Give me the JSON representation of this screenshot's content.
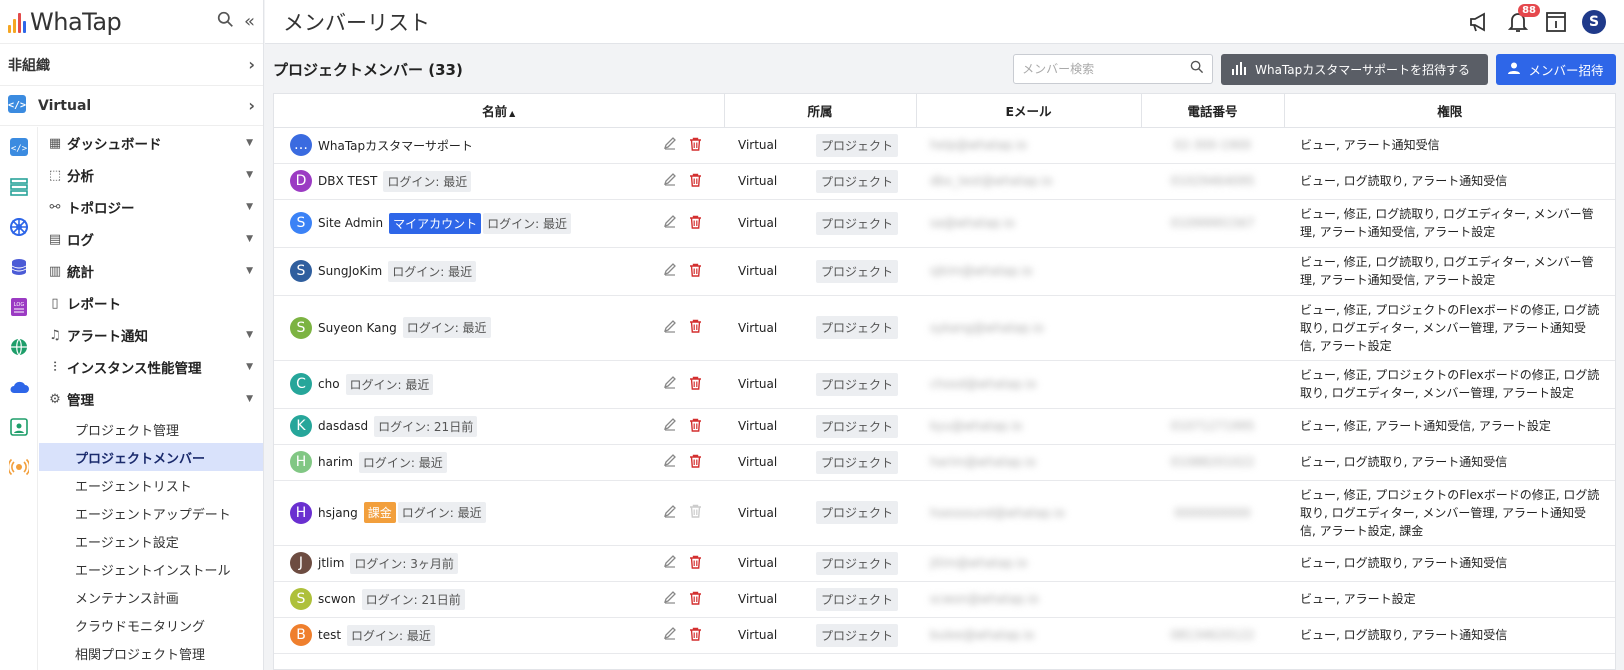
{
  "app": {
    "logo_text": "WhaTap"
  },
  "sidebar": {
    "org": "非組織",
    "project": "Virtual",
    "menu": [
      {
        "label": "ダッシュボード"
      },
      {
        "label": "分析"
      },
      {
        "label": "トポロジー"
      },
      {
        "label": "ログ"
      },
      {
        "label": "統計"
      },
      {
        "label": "レポート"
      },
      {
        "label": "アラート通知"
      },
      {
        "label": "インスタンス性能管理"
      },
      {
        "label": "管理"
      }
    ],
    "submenu": [
      {
        "label": "プロジェクト管理"
      },
      {
        "label": "プロジェクトメンバー"
      },
      {
        "label": "エージェントリスト"
      },
      {
        "label": "エージェントアップデート"
      },
      {
        "label": "エージェント設定"
      },
      {
        "label": "エージェントインストール"
      },
      {
        "label": "メンテナンス計画"
      },
      {
        "label": "クラウドモニタリング"
      },
      {
        "label": "相関プロジェクト管理"
      }
    ]
  },
  "topbar": {
    "title": "メンバーリスト",
    "notification_count": "88",
    "avatar_letter": "S"
  },
  "main": {
    "section_title": "プロジェクトメンバー (33)",
    "search_placeholder": "メンバー検索",
    "support_button": "WhaTapカスタマーサポートを招待する",
    "invite_button": "メンバー招待",
    "columns": {
      "name": "名前",
      "dept": "所属",
      "email": "Eメール",
      "phone": "電話番号",
      "perm": "権限"
    },
    "rows": [
      {
        "avatar": "…",
        "name": "WhaTapカスタマーサポート",
        "badge": "",
        "login": "",
        "dept": "Virtual",
        "role": "プロジェクト",
        "email": "help@whatap.io",
        "phone": "02-300-1900",
        "perm": "ビュー, アラート通知受信"
      },
      {
        "avatar": "D",
        "name": "DBX TEST",
        "badge": "",
        "login": "ログイン: 最近",
        "dept": "Virtual",
        "role": "プロジェクト",
        "email": "dbx_test@whatap.io",
        "phone": "01029464095",
        "perm": "ビュー, ログ読取り, アラート通知受信"
      },
      {
        "avatar": "S",
        "name": "Site Admin",
        "badge": "マイアカウント",
        "login": "ログイン: 最近",
        "dept": "Virtual",
        "role": "プロジェクト",
        "email": "sa@whatap.io",
        "phone": "01099991567",
        "perm": "ビュー, 修正, ログ読取り, ログエディター, メンバー管理, アラート通知受信, アラート設定"
      },
      {
        "avatar": "S",
        "name": "SungJoKim",
        "badge": "",
        "login": "ログイン: 最近",
        "dept": "Virtual",
        "role": "プロジェクト",
        "email": "sjkim@whatap.io",
        "phone": "",
        "perm": "ビュー, 修正, ログ読取り, ログエディター, メンバー管理, アラート通知受信, アラート設定"
      },
      {
        "avatar": "S",
        "name": "Suyeon Kang",
        "badge": "",
        "login": "ログイン: 最近",
        "dept": "Virtual",
        "role": "プロジェクト",
        "email": "sykang@whatap.io",
        "phone": "",
        "perm": "ビュー, 修正, プロジェクトのFlexボードの修正, ログ読取り, ログエディター, メンバー管理, アラート通知受信, アラート設定"
      },
      {
        "avatar": "C",
        "name": "cho",
        "badge": "",
        "login": "ログイン: 最近",
        "dept": "Virtual",
        "role": "プロジェクト",
        "email": "chosd@whatap.io",
        "phone": "",
        "perm": "ビュー, 修正, プロジェクトのFlexボードの修正, ログ読取り, ログエディター, メンバー管理, アラート設定"
      },
      {
        "avatar": "K",
        "name": "dasdasd",
        "badge": "",
        "login": "ログイン: 21日前",
        "dept": "Virtual",
        "role": "プロジェクト",
        "email": "kyu@whatap.io",
        "phone": "01071271995",
        "perm": "ビュー, 修正, アラート通知受信, アラート設定"
      },
      {
        "avatar": "H",
        "name": "harim",
        "badge": "",
        "login": "ログイン: 最近",
        "dept": "Virtual",
        "role": "プロジェクト",
        "email": "harim@whatap.io",
        "phone": "01088201022",
        "perm": "ビュー, ログ読取り, アラート通知受信"
      },
      {
        "avatar": "H",
        "name": "hsjang",
        "badge": "課金",
        "login": "ログイン: 最近",
        "dept": "Virtual",
        "role": "プロジェクト",
        "email": "hsessound@whatap.io",
        "phone": "0000000000",
        "perm": "ビュー, 修正, プロジェクトのFlexボードの修正, ログ読取り, ログエディター, メンバー管理, アラート通知受信, アラート設定, 課金"
      },
      {
        "avatar": "J",
        "name": "jtlim",
        "badge": "",
        "login": "ログイン: 3ヶ月前",
        "dept": "Virtual",
        "role": "プロジェクト",
        "email": "jtlim@whatap.io",
        "phone": "",
        "perm": "ビュー, ログ読取り, アラート通知受信"
      },
      {
        "avatar": "S",
        "name": "scwon",
        "badge": "",
        "login": "ログイン: 21日前",
        "dept": "Virtual",
        "role": "プロジェクト",
        "email": "scwon@whatap.io",
        "phone": "",
        "perm": "ビュー, アラート設定"
      },
      {
        "avatar": "B",
        "name": "test",
        "badge": "",
        "login": "ログイン: 最近",
        "dept": "Virtual",
        "role": "プロジェクト",
        "email": "bulee@whatap.io",
        "phone": "08134620122",
        "perm": "ビュー, ログ読取り, アラート通知受信"
      }
    ]
  },
  "colors": {
    "accent": "#2e66e8",
    "avatars": [
      "#3a6be0",
      "#9b3bc3",
      "#3b82f6",
      "#2f5e9e",
      "#7cb342",
      "#26a69a",
      "#26a69a",
      "#81c784",
      "#6a2fd0",
      "#6d4c41",
      "#aec03a",
      "#ef7f2d"
    ]
  }
}
